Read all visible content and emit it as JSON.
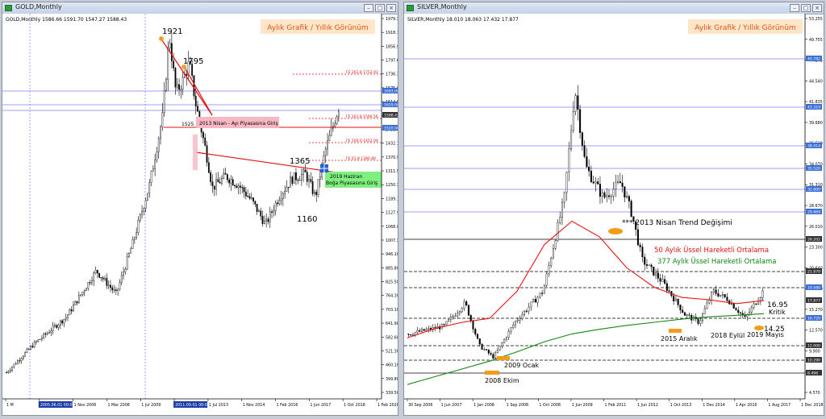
{
  "windows": [
    {
      "title": "GOLD,Monthly",
      "header_info": "GOLD,Monthly  1586.66 1591.70 1547.27 1588.43",
      "badge": "Aylık Grafik / Yıllık Görünüm",
      "price_axis": [
        "1979.30",
        "1918.10",
        "1856.90",
        "1797.60",
        "1736.30",
        "1675.00",
        "1614.60",
        "1554.20",
        "1493.00",
        "1432.10",
        "1370.90",
        "1311.50",
        "1250.30",
        "1189.10",
        "1127.90",
        "1068.00",
        "1007.30",
        "946.10",
        "885.80",
        "825.50",
        "764.30",
        "703.10",
        "641.90",
        "582.60",
        "521.30",
        "460.10",
        "399.80",
        "339.50"
      ],
      "time_axis": [
        "1 M",
        "2005.06.01 00:00",
        "1 Nov 2006",
        "1 Mar 2008",
        "1 Jul 2009",
        "2011.09.01 00:00",
        "1 Jul 2013",
        "1 Nov 2014",
        "1 Feb 2016",
        "1 Jun 2017",
        "1 Oct 2018",
        "1 Feb 2020"
      ],
      "price_tags": [
        "1693.00",
        "1629.00",
        "1588.43",
        "1520.00"
      ],
      "fib_levels": [
        "FE 261.8 1752.93",
        "FE 161.8 1566.56",
        "FE 100.0 1452.00",
        "FE 61.8 1380.80"
      ],
      "annotations": {
        "high_1921": "1921",
        "high_1795": "1795",
        "level_1525": "1525",
        "box_2013": "2013 Nisan - Ayı Piyasasına Giriş",
        "level_1365": "1365",
        "level_1160": "1160",
        "box_2019_l1": "2019 Haziran",
        "box_2019_l2": "Boğa Piyasasına Giriş"
      }
    },
    {
      "title": "SILVER,Monthly",
      "header_info": "SILVER,Monthly  18.010 18.063 17.432 17.877",
      "badge": "Aylık Grafik / Yıllık Görünüm",
      "price_axis": [
        "53.255",
        "49.755",
        "47.245",
        "44.540",
        "41.835",
        "39.680",
        "36.520",
        "34.070",
        "31.310",
        "28.670",
        "26.010",
        "23.300",
        "20.640",
        "17.930",
        "15.270",
        "12.570",
        "9.900",
        "7.235",
        "4.570"
      ],
      "time_axis": [
        "30 Sep 2006",
        "1 Jun 2007",
        "1 Jan 2008",
        "1 Sep 2008",
        "1 Oct 2008",
        "1 Jun 2009",
        "1 Feb 2011",
        "1 Jun 2012",
        "1 Oct 2013",
        "1 Dec 2014",
        "1 Apr 2016",
        "1 Aug 2017",
        "1 Dec 2018"
      ],
      "price_tags": [
        "45.782",
        "43.319",
        "38.414",
        "35.520",
        "32.800",
        "29.869",
        "26.202",
        "21.879",
        "19.580",
        "17.877",
        "16.720",
        "12.000",
        "10.290",
        "8.496"
      ],
      "annotations": {
        "trend_2013": "*** 2013 Nisan Trend Değişimi",
        "ema50": "50 Aylık Üssel Hareketli Ortalama",
        "ema377": "377 Aylık Üssel Hareketli Ortalama",
        "level_1695": "16.95",
        "kritik": "Kritik",
        "level_1425": "14.25",
        "may_2019": "2019 Mayıs",
        "sep_2018": "2018 Eylül",
        "dec_2015": "2015 Aralık",
        "jan_2009": "2009 Ocak",
        "oct_2008": "2008 Ekim"
      }
    }
  ],
  "colors": {
    "bull": "#ffffff",
    "bear": "#000000",
    "grid_blue": "#8080ff",
    "fib_red": "#e01010",
    "ema50": "#ee1111",
    "ema377": "#118811",
    "badge_bg": "#ffe6c8",
    "badge_text": "#e0501a",
    "pink_box": "#f7b8c4",
    "green_box": "#7ff07f",
    "tag_blue": "#3a6fd8",
    "marker_orange": "#f59b1a"
  },
  "chart_data": [
    {
      "type": "candlestick",
      "title": "GOLD,Monthly",
      "ylim": [
        339.5,
        1979.3
      ],
      "x": [
        "2005",
        "2006",
        "2007",
        "2008",
        "2009",
        "2010",
        "2011",
        "2012",
        "2013",
        "2014",
        "2015",
        "2016",
        "2017",
        "2018",
        "2019",
        "2020"
      ],
      "approx_close": [
        440,
        610,
        800,
        870,
        1100,
        1380,
        1600,
        1700,
        1220,
        1200,
        1060,
        1150,
        1300,
        1280,
        1515,
        1588
      ],
      "levels": [
        1921,
        1795,
        1525,
        1365,
        1160
      ]
    },
    {
      "type": "candlestick",
      "title": "SILVER,Monthly",
      "ylim": [
        4.57,
        53.255
      ],
      "x": [
        "2006",
        "2007",
        "2008",
        "2009",
        "2010",
        "2011",
        "2012",
        "2013",
        "2014",
        "2015",
        "2016",
        "2017",
        "2018",
        "2019"
      ],
      "approx_close": [
        12.5,
        13.5,
        11.0,
        14.5,
        28.0,
        30.0,
        29.5,
        20.0,
        16.0,
        14.0,
        17.0,
        17.0,
        14.5,
        17.9
      ],
      "series": [
        {
          "name": "50 Aylık Üssel Hareketli Ortalama",
          "values": [
            12.0,
            13.2,
            14.0,
            14.5,
            18.0,
            24.0,
            27.0,
            25.0,
            21.0,
            18.5,
            17.2,
            16.9,
            16.4,
            16.8
          ]
        },
        {
          "name": "377 Aylık Üssel Hareketli Ortalama",
          "values": [
            6.0,
            7.0,
            8.0,
            9.0,
            10.2,
            11.5,
            12.5,
            13.1,
            13.6,
            14.0,
            14.4,
            14.7,
            14.9,
            15.1
          ]
        }
      ],
      "levels": [
        16.95,
        14.25
      ]
    }
  ]
}
